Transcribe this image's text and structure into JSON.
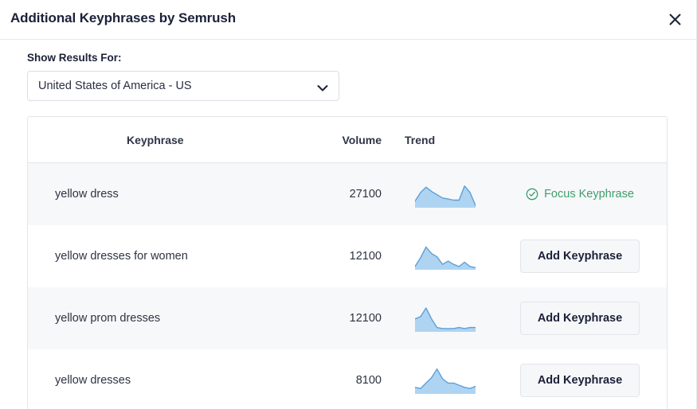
{
  "modal": {
    "title": "Additional Keyphrases by Semrush",
    "close_icon": "close-icon"
  },
  "filter": {
    "label": "Show Results For:",
    "selected": "United States of America - US",
    "chevron_icon": "chevron-down-icon"
  },
  "table": {
    "columns": [
      "Keyphrase",
      "Volume",
      "Trend"
    ],
    "rows": [
      {
        "keyphrase": "yellow dress",
        "volume": "27100",
        "action": "Focus Keyphrase",
        "action_type": "focus",
        "action_icon": "check-circle-icon",
        "trend": [
          38,
          22,
          12,
          20,
          26,
          32,
          34,
          36,
          36,
          10,
          22,
          46
        ]
      },
      {
        "keyphrase": "yellow dresses for women",
        "volume": "12100",
        "action": "Add Keyphrase",
        "action_type": "add",
        "trend": [
          44,
          28,
          8,
          20,
          26,
          40,
          34,
          40,
          44,
          36,
          44,
          46
        ]
      },
      {
        "keyphrase": "yellow prom dresses",
        "volume": "12100",
        "action": "Add Keyphrase",
        "action_type": "add",
        "trend": [
          26,
          22,
          6,
          26,
          42,
          44,
          44,
          44,
          42,
          44,
          42,
          42
        ]
      },
      {
        "keyphrase": "yellow dresses",
        "volume": "8100",
        "action": "Add Keyphrase",
        "action_type": "add",
        "trend": [
          38,
          40,
          30,
          20,
          4,
          22,
          30,
          30,
          34,
          38,
          40,
          36
        ]
      }
    ]
  },
  "colors": {
    "title": "#1b2138",
    "focus_green": "#3d9e6b",
    "spark_fill": "#aed4f2",
    "spark_stroke": "#5e9fd8",
    "row_alt": "#f7f8fa",
    "border": "#e2e5ea",
    "button_bg": "#f6f7f9"
  },
  "chart_data": {
    "type": "area",
    "title": "Keyphrase search volume trend sparklines",
    "xlabel": "",
    "ylabel": "",
    "grid": false,
    "legend": "none",
    "x": [
      1,
      2,
      3,
      4,
      5,
      6,
      7,
      8,
      9,
      10,
      11,
      12
    ],
    "series": [
      {
        "name": "yellow dress",
        "values": [
          38,
          22,
          12,
          20,
          26,
          32,
          34,
          36,
          36,
          10,
          22,
          46
        ]
      },
      {
        "name": "yellow dresses for women",
        "values": [
          44,
          28,
          8,
          20,
          26,
          40,
          34,
          40,
          44,
          36,
          44,
          46
        ]
      },
      {
        "name": "yellow prom dresses",
        "values": [
          26,
          22,
          6,
          26,
          42,
          44,
          44,
          44,
          42,
          44,
          42,
          42
        ]
      },
      {
        "name": "yellow dresses",
        "values": [
          38,
          40,
          30,
          20,
          4,
          22,
          30,
          30,
          34,
          38,
          40,
          36
        ]
      }
    ]
  }
}
